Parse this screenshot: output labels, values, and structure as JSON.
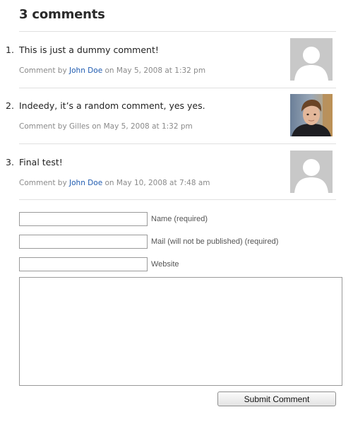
{
  "heading": {
    "title": "3 comments"
  },
  "comments": [
    {
      "number": "1.",
      "text": "This is just a dummy comment!",
      "prefix": "Comment by",
      "author": "John Doe",
      "author_is_link": true,
      "date_line": "on May 5, 2008 at 1:32 pm",
      "avatar": "default-avatar-icon"
    },
    {
      "number": "2.",
      "text": "Indeedy, it’s a random comment, yes yes.",
      "prefix": "Comment by",
      "author": "Gilles",
      "author_is_link": false,
      "date_line": "on May 5, 2008 at 1:32 pm",
      "avatar": "user-photo"
    },
    {
      "number": "3.",
      "text": "Final test!",
      "prefix": "Comment by",
      "author": "John Doe",
      "author_is_link": true,
      "date_line": "on May 10, 2008 at 7:48 am",
      "avatar": "default-avatar-icon"
    }
  ],
  "form": {
    "name_label": "Name (required)",
    "name_value": "",
    "mail_label": "Mail (will not be published) (required)",
    "mail_value": "",
    "website_label": "Website",
    "website_value": "",
    "comment_value": "",
    "submit_label": "Submit Comment"
  },
  "colors": {
    "link": "#1f5bb0",
    "meta_text": "#8a8a8a",
    "rule": "#e0e0e0",
    "avatar_bg": "#c8c8c8"
  }
}
